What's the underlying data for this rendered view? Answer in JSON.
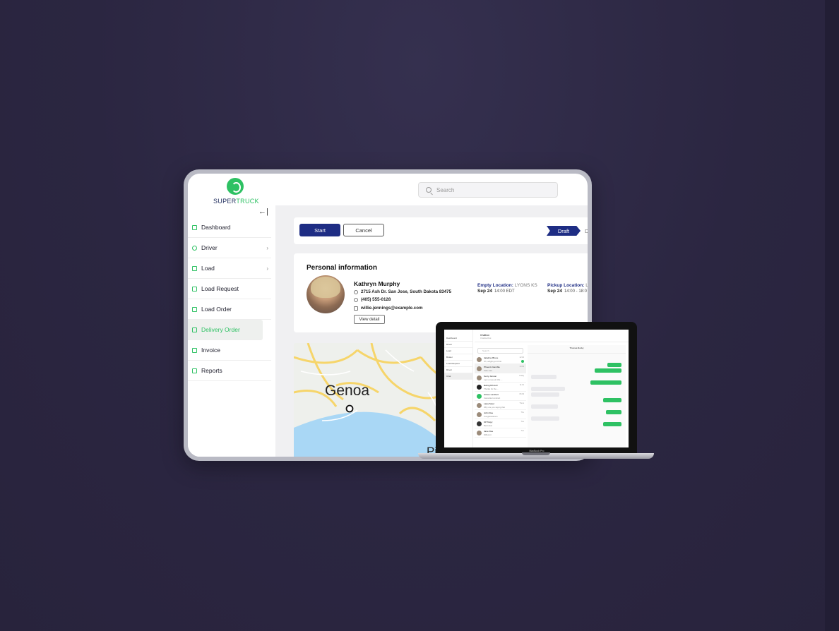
{
  "brand": {
    "name_prefix": "SUPER",
    "name_suffix": "TRUCK"
  },
  "collapse_icon": "←|",
  "search": {
    "placeholder": "Search"
  },
  "nav": [
    {
      "label": "Dashboard",
      "icon": "dashboard-icon",
      "has_children": false
    },
    {
      "label": "Driver",
      "icon": "driver-icon",
      "has_children": true
    },
    {
      "label": "Load",
      "icon": "truck-icon",
      "has_children": true
    },
    {
      "label": "Load Request",
      "icon": "load-request-icon",
      "has_children": false
    },
    {
      "label": "Load Order",
      "icon": "load-order-icon",
      "has_children": false
    },
    {
      "label": "Delivery Order",
      "icon": "delivery-order-icon",
      "has_children": false,
      "active": true
    },
    {
      "label": "Invoice",
      "icon": "invoice-icon",
      "has_children": false
    },
    {
      "label": "Reports",
      "icon": "reports-icon",
      "has_children": false
    }
  ],
  "actions": {
    "start": "Start",
    "cancel": "Cancel",
    "status_current": "Draft",
    "status_next": "D"
  },
  "personal_info": {
    "title": "Personal information",
    "name": "Kathryn Murphy",
    "address": "2715 Ash Dr. San Jose, South Dakota 83475",
    "phone": "(405) 555-0128",
    "email": "willie.jennings@example.com",
    "view_detail": "View detail",
    "empty_location": {
      "label": "Empty Location:",
      "value": "LYONS KS",
      "date": "Sep 24",
      "time": "14:00 EDT"
    },
    "pickup_location": {
      "label": "Pickup Location:",
      "value": "LY",
      "date": "Sep 24",
      "time": "14:00 - 18:0"
    }
  },
  "map": {
    "city": "Genoa",
    "city_partial": "Pi"
  },
  "laptop": {
    "header_title": "Chatbox",
    "header_sub": "Chatbox/chat",
    "search_placeholder": "Search",
    "chat_title": "Thomas Rocky",
    "nav": [
      "Dashboard",
      "Driver",
      "Load",
      "Broker",
      "Load Request",
      "Driver",
      "Chat"
    ],
    "conversations": [
      {
        "name": "Jakeline Bruce",
        "msg": "Oh, alright got it first",
        "time": "12:02",
        "unread": true
      },
      {
        "name": "Phoenix Gamble",
        "msg": "Take care",
        "time": "10:09"
      },
      {
        "name": "Kerry Jonson",
        "msg": "I got a new job this ...",
        "time": "Today"
      },
      {
        "name": "Ewing Driscoll",
        "msg": "Thanks for the ...",
        "time": "11:01"
      },
      {
        "name": "Aimee Lambert",
        "msg": "Cancelled contract",
        "time": "06:03"
      },
      {
        "name": "Lana Suter",
        "msg": "Why are you saying that",
        "time": "Thurs"
      },
      {
        "name": "John Doe",
        "msg": "Congratulations",
        "time": "Thu"
      },
      {
        "name": "KP Tarpy",
        "msg": "Best deal",
        "time": "Tue"
      },
      {
        "name": "Jane Doe",
        "msg": "Different",
        "time": "Tue"
      }
    ],
    "device_label": "MacBook Pro"
  },
  "colors": {
    "accent_green": "#2ec163",
    "primary_navy": "#1e2d84",
    "background": "#2c2742"
  }
}
